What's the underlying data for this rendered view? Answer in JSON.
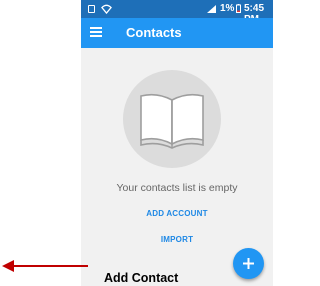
{
  "status_bar": {
    "battery_text": "1%",
    "time": "5:45 PM",
    "icons": [
      "sim-card-icon",
      "wifi-icon",
      "signal-icon",
      "battery-icon"
    ]
  },
  "app_bar": {
    "menu_icon": "menu-icon",
    "title": "Contacts"
  },
  "empty_state": {
    "icon": "open-book-icon",
    "message": "Your contacts list is empty"
  },
  "actions": {
    "add_account": "ADD ACCOUNT",
    "import": "IMPORT"
  },
  "fab": {
    "icon": "plus-icon"
  },
  "annotation": {
    "label": "Add Contact",
    "arrow_color": "#c00000"
  },
  "colors": {
    "app_bar": "#2196f3",
    "status_bar": "#1e6fb8",
    "link": "#1e88e5",
    "background": "#f1f1f1"
  }
}
